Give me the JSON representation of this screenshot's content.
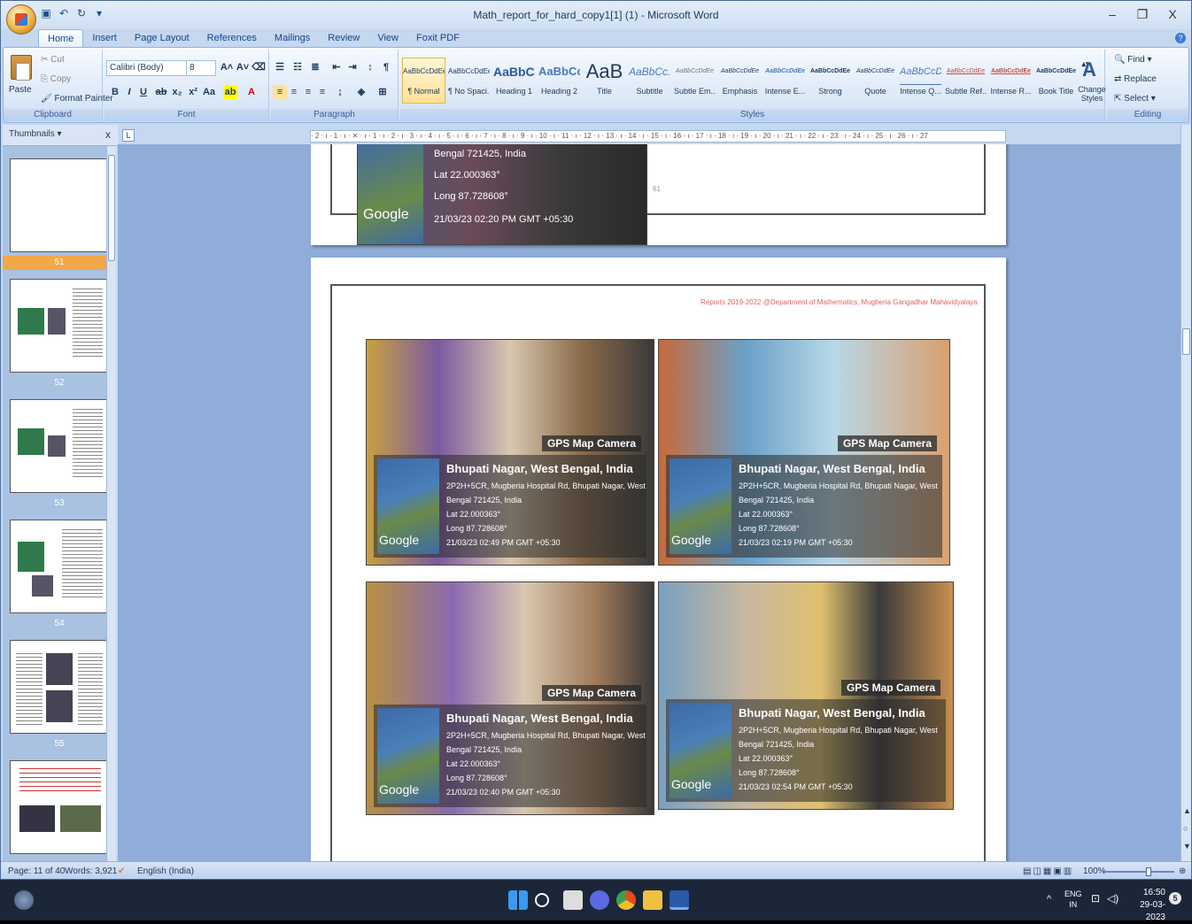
{
  "window": {
    "title": "Math_report_for_hard_copy1[1] (1) - Microsoft Word",
    "minimize": "–",
    "maximize": "❐",
    "close": "X"
  },
  "tabs": [
    "Home",
    "Insert",
    "Page Layout",
    "References",
    "Mailings",
    "Review",
    "View",
    "Foxit PDF"
  ],
  "clipboard": {
    "paste": "Paste",
    "cut": "Cut",
    "copy": "Copy",
    "format_painter": "Format Painter",
    "label": "Clipboard"
  },
  "font": {
    "family": "Calibri (Body)",
    "size": "8",
    "label": "Font"
  },
  "paragraph": {
    "label": "Paragraph"
  },
  "styles": {
    "label": "Styles",
    "items": [
      {
        "preview": "AaBbCcDdEe",
        "name": "¶ Normal"
      },
      {
        "preview": "AaBbCcDdEe",
        "name": "¶ No Spaci..."
      },
      {
        "preview": "AaBbC(",
        "name": "Heading 1"
      },
      {
        "preview": "AaBbCc",
        "name": "Heading 2"
      },
      {
        "preview": "AaB",
        "name": "Title"
      },
      {
        "preview": "AaBbCc.",
        "name": "Subtitle"
      },
      {
        "preview": "AaBbCcDdEe",
        "name": "Subtle Em..."
      },
      {
        "preview": "AaBbCcDdEe",
        "name": "Emphasis"
      },
      {
        "preview": "AaBbCcDdEe",
        "name": "Intense E..."
      },
      {
        "preview": "AaBbCcDdEe",
        "name": "Strong"
      },
      {
        "preview": "AaBbCcDdEe",
        "name": "Quote"
      },
      {
        "preview": "AaBbCcD(",
        "name": "Intense Q..."
      },
      {
        "preview": "AaBbCcDdEe",
        "name": "Subtle Ref..."
      },
      {
        "preview": "AaBbCcDdEe",
        "name": "Intense R..."
      },
      {
        "preview": "AaBbCcDdEe",
        "name": "Book Title"
      }
    ],
    "change_styles": "Change Styles"
  },
  "editing": {
    "find": "Find",
    "replace": "Replace",
    "select": "Select",
    "label": "Editing"
  },
  "thumbnails": {
    "header": "Thumbnails",
    "close": "x",
    "pages": [
      "51",
      "52",
      "53",
      "54",
      "55"
    ]
  },
  "ruler": {
    "marks": "· 2 · ı · 1 · ı · ✕ · ı · 1 · ı · 2 · ı · 3 · ı · 4 · ı · 5 · ı · 6 · ı · 7 · ı · 8 · ı · 9 · ı · 10 · ı · 11 · ı · 12 · ı · 13 · ı · 14 · ı · 15 · ı · 16 · ı · 17 · ı · 18 · ı · 19 · ı · 20 · ı · 21 · ı · 22 · ı · 23 · ı · 24 · ı · 25 · ı · 26 · ı · 27",
    "tab_selector": "L"
  },
  "prev_page": {
    "line1": "Bengal 721425, India",
    "lat": "Lat 22.000363°",
    "long": "Long 87.728608°",
    "timestamp": "21/03/23 02:20 PM GMT +05:30",
    "google": "Google",
    "page_number": "61"
  },
  "page": {
    "header_text": "Reports 2019-2022 @Department of Mathematics, Mugberia Gangadhar Mahavidyalaya"
  },
  "photos": [
    {
      "cam": "GPS Map Camera",
      "place": "Bhupati Nagar, West Bengal, India",
      "addr1": "2P2H+5CR, Mugberia Hospital Rd, Bhupati Nagar, West",
      "addr2": "Bengal 721425, India",
      "lat": "Lat 22.000363°",
      "long": "Long 87.728608°",
      "time": "21/03/23 02:49 PM GMT +05:30",
      "google": "Google"
    },
    {
      "cam": "GPS Map Camera",
      "place": "Bhupati Nagar, West Bengal, India",
      "addr1": "2P2H+5CR, Mugberia Hospital Rd, Bhupati Nagar, West",
      "addr2": "Bengal 721425, India",
      "lat": "Lat 22.000363°",
      "long": "Long 87.728608°",
      "time": "21/03/23 02:19 PM GMT +05:30",
      "google": "Google"
    },
    {
      "cam": "GPS Map Camera",
      "place": "Bhupati Nagar, West Bengal, India",
      "addr1": "2P2H+5CR, Mugberia Hospital Rd, Bhupati Nagar, West",
      "addr2": "Bengal 721425, India",
      "lat": "Lat 22.000363°",
      "long": "Long 87.728608°",
      "time": "21/03/23 02:40 PM GMT +05:30",
      "google": "Google"
    },
    {
      "cam": "GPS Map Camera",
      "place": "Bhupati Nagar, West Bengal, India",
      "addr1": "2P2H+5CR, Mugberia Hospital Rd, Bhupati Nagar, West",
      "addr2": "Bengal 721425, India",
      "lat": "Lat 22.000363°",
      "long": "Long 87.728608°",
      "time": "21/03/23 02:54 PM GMT +05:30",
      "google": "Google"
    }
  ],
  "status": {
    "page": "Page: 11 of 40",
    "words": "Words: 3,921",
    "language": "English (India)",
    "zoom": "100%"
  },
  "taskbar": {
    "lang1": "ENG",
    "lang2": "IN",
    "time": "16:50",
    "date": "29-03-2023",
    "notif": "5"
  },
  "colors": {
    "accent": "#f0a848",
    "ribbon": "#dbe8f8",
    "taskbar": "#1b2738"
  }
}
